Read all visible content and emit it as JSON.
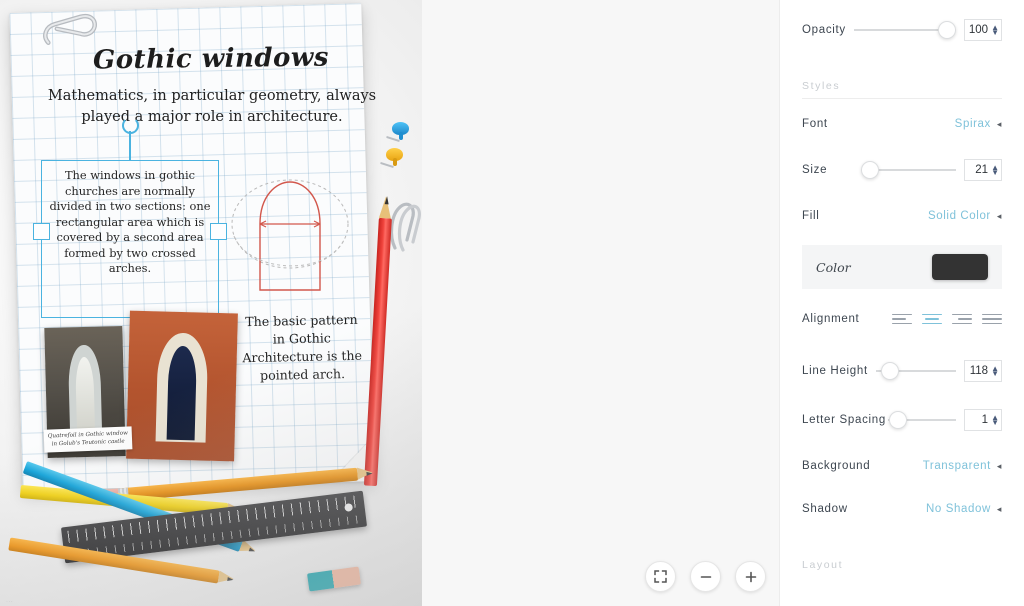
{
  "canvas": {
    "poster": {
      "title": "Gothic windows",
      "intro": "Mathematics, in particular geometry, always played a major role in architecture.",
      "selected_text": "The windows in gothic churches are normally divided in two sections: one rectangular area which is covered by a second area formed by two crossed arches.",
      "side_text": "The basic pattern in Gothic Architecture is the pointed arch.",
      "caption": "Quatrefoil in Gothic window in Golub's Teutonic castle"
    },
    "watermark": "..."
  },
  "zoom_controls": {
    "fit_label": "fit-screen-icon",
    "zoom_out_label": "−",
    "zoom_in_label": "+"
  },
  "panel": {
    "opacity": {
      "label": "Opacity",
      "value": "100",
      "knob_pct": 92
    },
    "styles_section": "Styles",
    "font": {
      "label": "Font",
      "value": "Spirax"
    },
    "size": {
      "label": "Size",
      "value": "21",
      "knob_pct": 2
    },
    "fill": {
      "label": "Fill",
      "value": "Solid Color"
    },
    "color": {
      "label": "Color",
      "hex": "#333333"
    },
    "alignment": {
      "label": "Alignment",
      "options": [
        "left",
        "center",
        "right",
        "justify"
      ],
      "selected": "center"
    },
    "line_height": {
      "label": "Line Height",
      "value": "118",
      "knob_pct": 16
    },
    "letter_spacing": {
      "label": "Letter Spacing",
      "value": "1",
      "knob_pct": 6
    },
    "background": {
      "label": "Background",
      "value": "Transparent"
    },
    "shadow": {
      "label": "Shadow",
      "value": "No Shadow"
    },
    "layout_section": "Layout"
  }
}
